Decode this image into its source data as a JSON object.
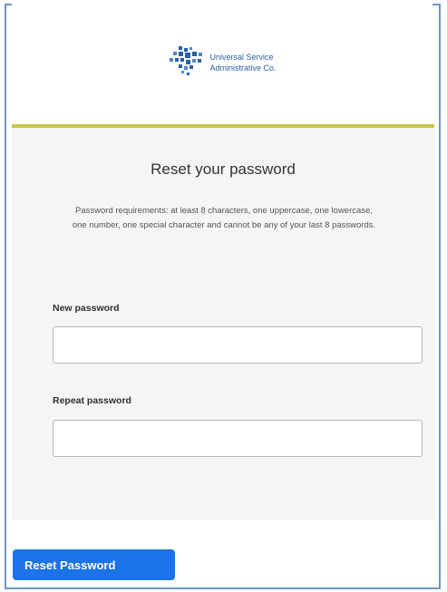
{
  "brand": {
    "line1": "Universal Service",
    "line2": "Administrative Co.",
    "primary_color": "#2b5fa8",
    "accent_color": "#c7c64a"
  },
  "form": {
    "title": "Reset your password",
    "requirements": "Password requirements: at least 8 characters, one uppercase, one lowercase, one number, one special character and cannot be any of your last 8 passwords.",
    "new_password_label": "New password",
    "new_password_value": "",
    "repeat_password_label": "Repeat password",
    "repeat_password_value": "",
    "submit_label": "Reset Password",
    "submit_color": "#1a73e8"
  },
  "icons": {
    "logo": "usac-logo-icon"
  }
}
